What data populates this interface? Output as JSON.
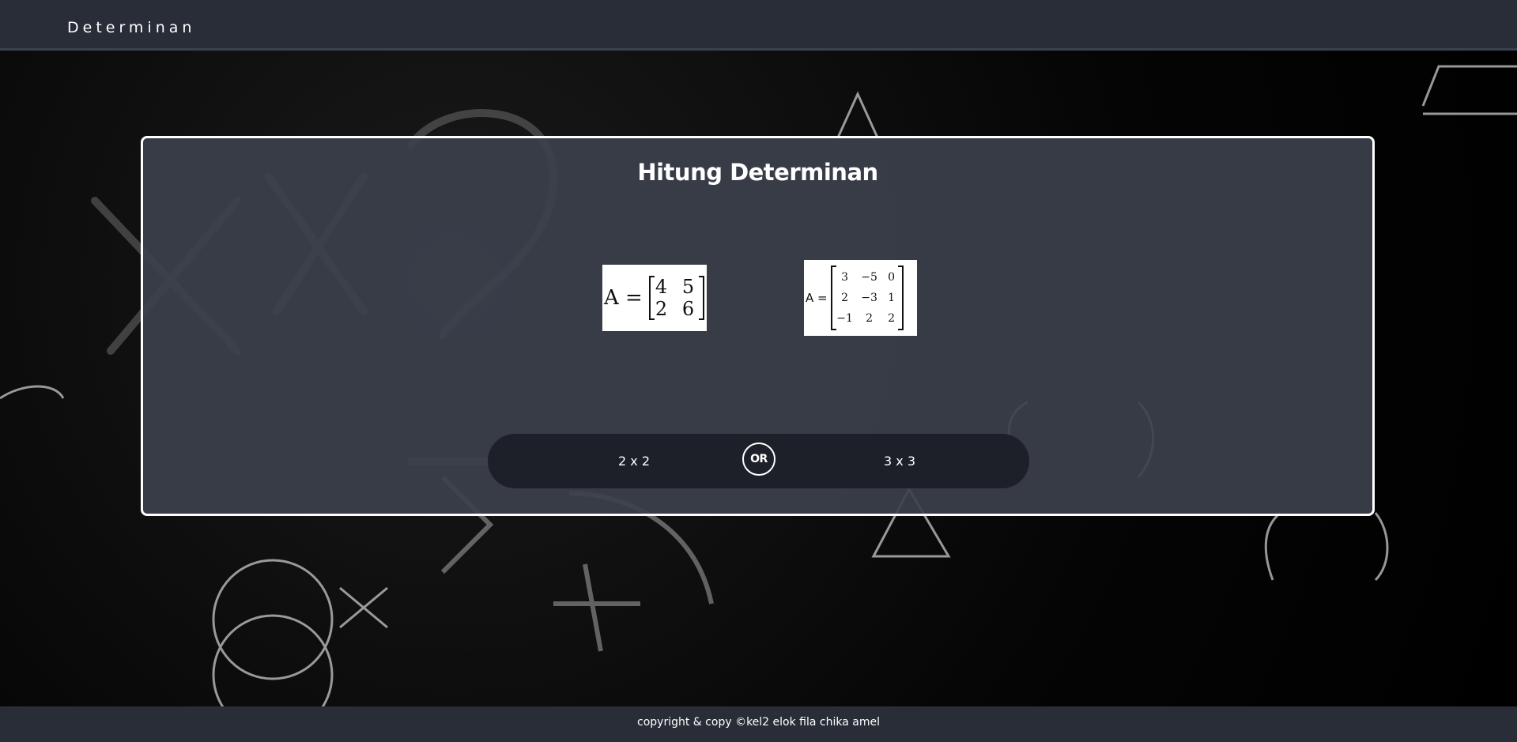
{
  "header": {
    "brand": "Determinan"
  },
  "card": {
    "title": "Hitung Determinan"
  },
  "matrix_2x2": {
    "label": "A =",
    "rows": [
      [
        "4",
        "5"
      ],
      [
        "2",
        "6"
      ]
    ]
  },
  "matrix_3x3": {
    "label": "A =",
    "rows": [
      [
        "3",
        "−5",
        "0"
      ],
      [
        "2",
        "−3",
        "1"
      ],
      [
        "−1",
        "2",
        "2"
      ]
    ]
  },
  "choices": {
    "option_2x2": "2 x 2",
    "separator": "OR",
    "option_3x3": "3 x 3"
  },
  "footer": {
    "text": "copyright & copy ©kel2 elok fila chika amel"
  },
  "colors": {
    "header_bg": "#282d38",
    "card_bg": "#3c404c",
    "choice_bar_bg": "#1e2029",
    "text": "#ffffff"
  },
  "icons": {
    "background": "chalkboard-math-doodles"
  }
}
